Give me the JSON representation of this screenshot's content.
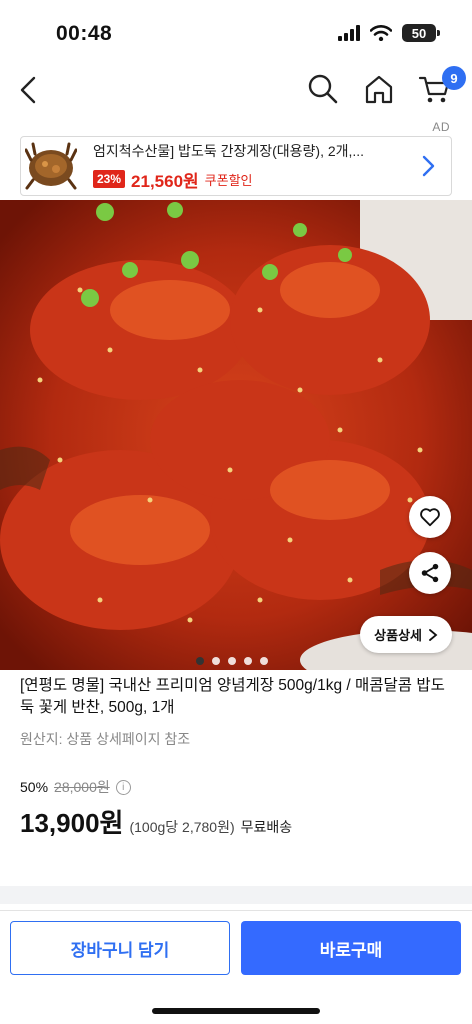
{
  "status": {
    "time": "00:48",
    "battery": "50"
  },
  "nav": {
    "cart_count": "9"
  },
  "ad": {
    "label": "AD",
    "title": "엄지척수산물] 밥도둑 간장게장(대용량), 2개,...",
    "discount": "23%",
    "price": "21,560원",
    "coupon": "쿠폰할인"
  },
  "hero": {
    "detail_label": "상품상세",
    "image_count": 5,
    "current_image": 1
  },
  "product": {
    "title": "[연평도 명물] 국내산 프리미엄 양념게장 500g/1kg / 매콤달콤 밥도둑 꽃게 반찬, 500g, 1개",
    "origin": "원산지: 상품 상세페이지 참조",
    "discount_rate": "50%",
    "original_price": "28,000원",
    "price": "13,900원",
    "unit_price": "(100g당 2,780원)",
    "shipping": "무료배송"
  },
  "actions": {
    "cart_label": "장바구니 담기",
    "buy_label": "바로구매"
  },
  "colors": {
    "accent": "#2f6ff2",
    "sale": "#e0261a"
  }
}
